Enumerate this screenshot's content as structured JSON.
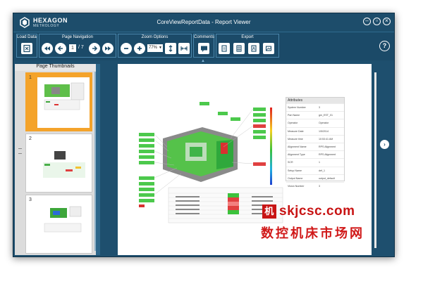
{
  "app": {
    "logo": "HEXAGON",
    "logo_sub": "METROLOGY",
    "title": "CoreViewReportData  -  Report Viewer"
  },
  "toolbar": {
    "load_data": "Load Data",
    "page_navigation": "Page Navigation",
    "current_page": "1",
    "total_pages": "/ 7",
    "zoom_options": "Zoom Options",
    "zoom_value": "77%",
    "comments": "Comments",
    "export": "Export"
  },
  "thumbnails": {
    "title": "Page Thumbnails",
    "items": [
      {
        "number": "1",
        "selected": true
      },
      {
        "number": "2",
        "selected": false
      },
      {
        "number": "3",
        "selected": false
      }
    ]
  },
  "report": {
    "attributes_title": "Attributes",
    "attributes": [
      {
        "key": "System Number",
        "value": "3"
      },
      {
        "key": "Part Name",
        "value": "gm_EST_01"
      },
      {
        "key": "Operator",
        "value": "Operator"
      },
      {
        "key": "Measure Date",
        "value": "1/5/2014"
      },
      {
        "key": "Measure time",
        "value": "10:53:41 AM"
      },
      {
        "key": "Alignment Name",
        "value": "RPS Alignment"
      },
      {
        "key": "Alignment Type",
        "value": "RPS Alignment"
      },
      {
        "key": "SCR",
        "value": "1"
      },
      {
        "key": "Setup Name",
        "value": "def_1"
      },
      {
        "key": "Output Name",
        "value": "output_default"
      },
      {
        "key": "Vision Number",
        "value": "3"
      }
    ]
  },
  "watermark": {
    "badge": "机",
    "url": "skjcsc.com",
    "text": "数控机床市场网"
  },
  "colors": {
    "title_bar": "#1d4d6b",
    "toolbar": "#1b4a68",
    "selection": "#f4a32a",
    "watermark": "#c81414"
  }
}
